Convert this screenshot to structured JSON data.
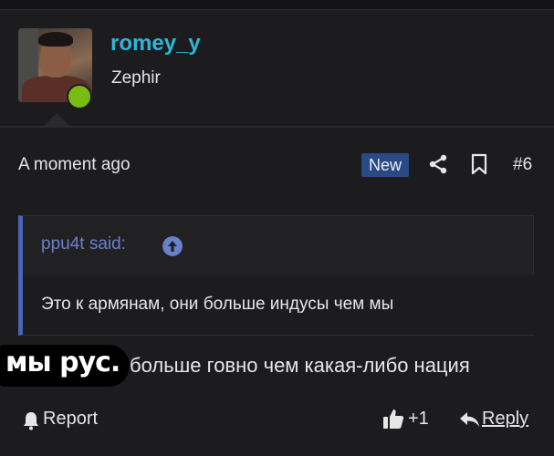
{
  "user": {
    "username": "romey_y",
    "title": "Zephir",
    "online": true
  },
  "post": {
    "timestamp": "A moment ago",
    "badge": "New",
    "number": "#6",
    "quote": {
      "author_line": "ppu4t said:",
      "text": "Это к армянам, они больше индусы чем мы"
    },
    "sticker_text": "мы рус.",
    "message": "больше говно чем какая-либо нация"
  },
  "actions": {
    "report": "Report",
    "likes": "+1",
    "reply": "Reply"
  },
  "icons": {
    "share": "share-icon",
    "bookmark": "bookmark-icon",
    "quote_arrow": "arrow-up-circle-icon",
    "report": "bell-icon",
    "like": "thumbs-up-icon",
    "reply": "reply-icon"
  },
  "colors": {
    "username": "#2fb6d6",
    "online": "#7cbb13",
    "badge": "#2a4a86",
    "quote_accent": "#6a80c8"
  }
}
